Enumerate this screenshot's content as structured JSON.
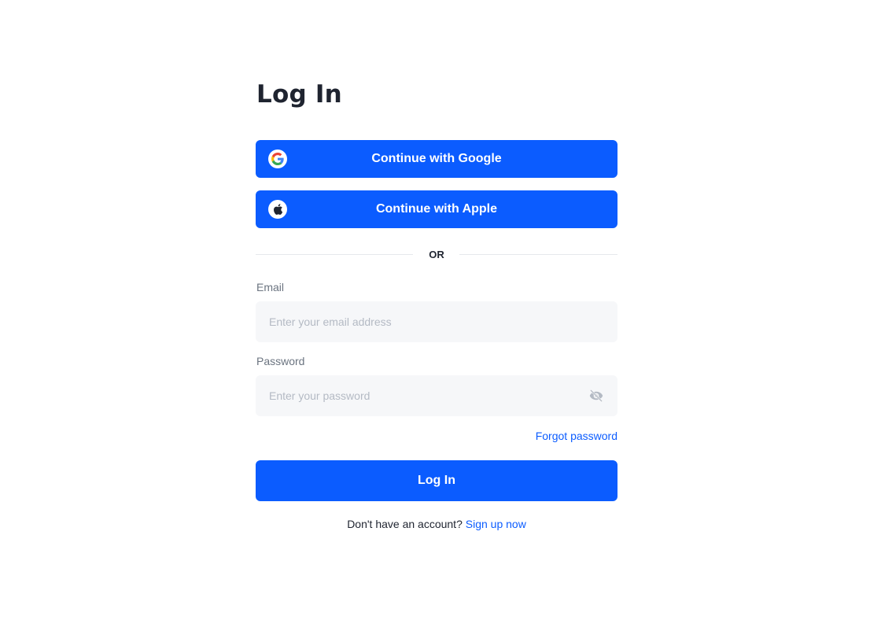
{
  "page": {
    "title": "Log In"
  },
  "social": {
    "google": {
      "label": "Continue with Google",
      "icon": "google-icon"
    },
    "apple": {
      "label": "Continue with Apple",
      "icon": "apple-icon"
    }
  },
  "divider": {
    "text": "OR"
  },
  "form": {
    "email": {
      "label": "Email",
      "placeholder": "Enter your email address",
      "value": ""
    },
    "password": {
      "label": "Password",
      "placeholder": "Enter your password",
      "value": "",
      "toggle_icon": "eye-off-icon"
    },
    "forgot_label": "Forgot password",
    "submit_label": "Log In"
  },
  "signup": {
    "prompt": "Don't have an account?",
    "link_label": "Sign up now"
  },
  "colors": {
    "primary": "#0b5cff",
    "input_bg": "#f6f7f9",
    "text": "#1f2430",
    "muted": "#6b7480",
    "placeholder": "#b4bac4"
  }
}
